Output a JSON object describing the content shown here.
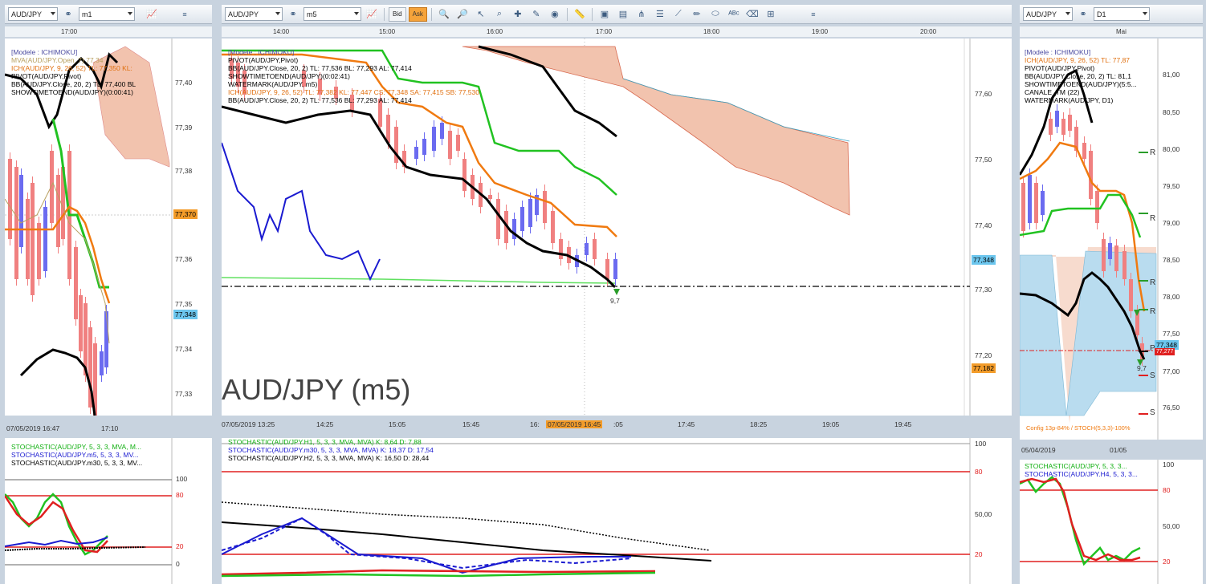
{
  "left": {
    "symbol": "AUD/JPY",
    "timeframe": "m1",
    "top_time": "17:00",
    "legend": [
      {
        "text": "[Modele : ICHIMOKU]",
        "color": "#4a4aa0"
      },
      {
        "text": "MVA(AUD/JPY.Open, 7) 77,34",
        "color": "#b8a060"
      },
      {
        "text": "ICH(AUD/JPY, 9, 26, 52) TL: 77,350  KL:",
        "color": "#e07010"
      },
      {
        "text": "PIVOT(AUD/JPY,Pivot)",
        "color": "#000"
      },
      {
        "text": "BB(AUD/JPY.Close, 20, 2)  TL: 77,400  BL",
        "color": "#000"
      },
      {
        "text": "SHOWTIMETOEND(AUD/JPY)(0:00:41)",
        "color": "#000"
      }
    ],
    "yaxis": [
      "77,40",
      "77,39",
      "77,38",
      "77,370",
      "77,36",
      "77,35",
      "77,348",
      "77,34",
      "77,33"
    ],
    "tag_orange": "77,370",
    "tag_blue": "77,348",
    "bottom_dates": [
      "07/05/2019 16:47",
      "17:10"
    ],
    "stoch_legend": [
      {
        "text": "STOCHASTIC(AUD/JPY, 5, 3, 3, MVA, M...",
        "color": "#12b012"
      },
      {
        "text": "STOCHASTIC(AUD/JPY.m5, 5, 3, 3, MV...",
        "color": "#1a1ad0"
      },
      {
        "text": "STOCHASTIC(AUD/JPY.m30, 5, 3, 3, MV...",
        "color": "#000"
      }
    ],
    "stoch_axis": [
      "100",
      "80",
      "20",
      "0"
    ]
  },
  "center": {
    "symbol": "AUD/JPY",
    "timeframe": "m5",
    "bid_label": "Bid",
    "ask_label": "Ask",
    "top_times": [
      "14:00",
      "15:00",
      "16:00",
      "17:00",
      "18:00",
      "19:00",
      "20:00"
    ],
    "legend": [
      {
        "text": "[Modele : ICHIMOKU]",
        "color": "#4a4aa0"
      },
      {
        "text": "PIVOT(AUD/JPY,Pivot)",
        "color": "#000"
      },
      {
        "text": "BB(AUD/JPY.Close, 20, 2)  TL: 77,536  BL: 77,293  AL: 77,414",
        "color": "#000",
        "extra": "AL: 77,414"
      },
      {
        "text": "SHOWTIMETOEND(AUD/JPY)(0:02:41)",
        "color": "#000"
      },
      {
        "text": "WATERMARK(AUD/JPY, m5)",
        "color": "#000"
      },
      {
        "text": "ICH(AUD/JPY, 9, 26, 52)  TL: 77,382  KL: 77,447  CS: 77,348  SA: 77,415  SB: 77,530",
        "color": "#e07010"
      },
      {
        "text": "BB(AUD/JPY.Close, 20, 2)  TL: 77,536  BL: 77,293  AL: 77,414",
        "color": "#000"
      }
    ],
    "yaxis": [
      "77,60",
      "77,50",
      "77,40",
      "77,348",
      "77,30",
      "77,20",
      "77,182"
    ],
    "tag_blue": "77,348",
    "tag_orange": "77,182",
    "watermark": "AUD/JPY (m5)",
    "marker_label": "9,7",
    "bottom_dates": [
      "07/05/2019 13:25",
      "14:25",
      "15:05",
      "15:45",
      "16:",
      "07/05/2019 16:45",
      ":05",
      "17:45",
      "18:25",
      "19:05",
      "19:45"
    ],
    "stoch_legend": [
      {
        "text": "STOCHASTIC(AUD/JPY.H1, 5, 3, 3, MVA, MVA)  K: 8,64  D: 7,88",
        "color": "#12b012"
      },
      {
        "text": "STOCHASTIC(AUD/JPY.m30, 5, 3, 3, MVA, MVA)  K: 18,37  D: 17,54",
        "color": "#1a1ad0"
      },
      {
        "text": "STOCHASTIC(AUD/JPY.H2, 5, 3, 3, MVA, MVA)  K: 16,50  D: 28,44",
        "color": "#000"
      }
    ],
    "stoch_axis": [
      "100",
      "80",
      "50,00",
      "20"
    ]
  },
  "right": {
    "symbol": "AUD/JPY",
    "timeframe": "D1",
    "top_time": "Mai",
    "legend": [
      {
        "text": "[Modele : ICHIMOKU]",
        "color": "#4a4aa0"
      },
      {
        "text": "ICH(AUD/JPY, 9, 26, 52)  TL: 77,87",
        "color": "#e07010"
      },
      {
        "text": "PIVOT(AUD/JPY,Pivot)",
        "color": "#000"
      },
      {
        "text": "BB(AUD/JPY.Close, 20, 2)  TL: 81,1",
        "color": "#000"
      },
      {
        "text": "SHOWTIMETOEND(AUD/JPY)(5:5...",
        "color": "#000"
      },
      {
        "text": "CANALE_TM (22)",
        "color": "#000"
      },
      {
        "text": "WATERMARK(AUD/JPY, D1)",
        "color": "#000"
      }
    ],
    "yaxis": [
      "81,00",
      "80,50",
      "80,00",
      "79,50",
      "79,00",
      "78,50",
      "78,00",
      "77,50",
      "77,348",
      "77,00",
      "76,50"
    ],
    "tag_blue": "77,348",
    "tag_red": "77,277",
    "pivot_labels": [
      "R",
      "R",
      "R",
      "R",
      "P",
      "S",
      "S"
    ],
    "marker_label": "9,7",
    "footer": "Config 13p-84% / STOCH(5,3,3)-100%",
    "bottom_dates": [
      "05/04/2019",
      "01/05"
    ],
    "stoch_legend": [
      {
        "text": "STOCHASTIC(AUD/JPY, 5, 3, 3...",
        "color": "#12b012"
      },
      {
        "text": "STOCHASTIC(AUD/JPY.H4, 5, 3, 3...",
        "color": "#1a1ad0"
      }
    ],
    "stoch_axis": [
      "100",
      "80",
      "50,00",
      "20"
    ]
  }
}
